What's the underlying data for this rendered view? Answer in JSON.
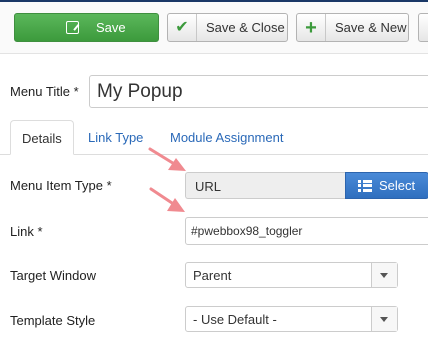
{
  "toolbar": {
    "save_label": "Save",
    "save_close_label": "Save & Close",
    "save_new_label": "Save & New"
  },
  "form": {
    "menu_title_label": "Menu Title *",
    "menu_title_value": "My Popup"
  },
  "tabs": [
    {
      "label": "Details",
      "active": true
    },
    {
      "label": "Link Type",
      "active": false
    },
    {
      "label": "Module Assignment",
      "active": false
    }
  ],
  "details": {
    "menu_item_type_label": "Menu Item Type *",
    "menu_item_type_value": "URL",
    "select_button_label": "Select",
    "link_label": "Link *",
    "link_value": "#pwebbox98_toggler",
    "target_window_label": "Target Window",
    "target_window_value": "Parent",
    "template_style_label": "Template Style",
    "template_style_value": "- Use Default -"
  },
  "colors": {
    "save_green": "#4cae4c",
    "select_blue": "#3a7bd0",
    "link_blue": "#2a69b8",
    "arrow_pink": "#f08a90"
  }
}
